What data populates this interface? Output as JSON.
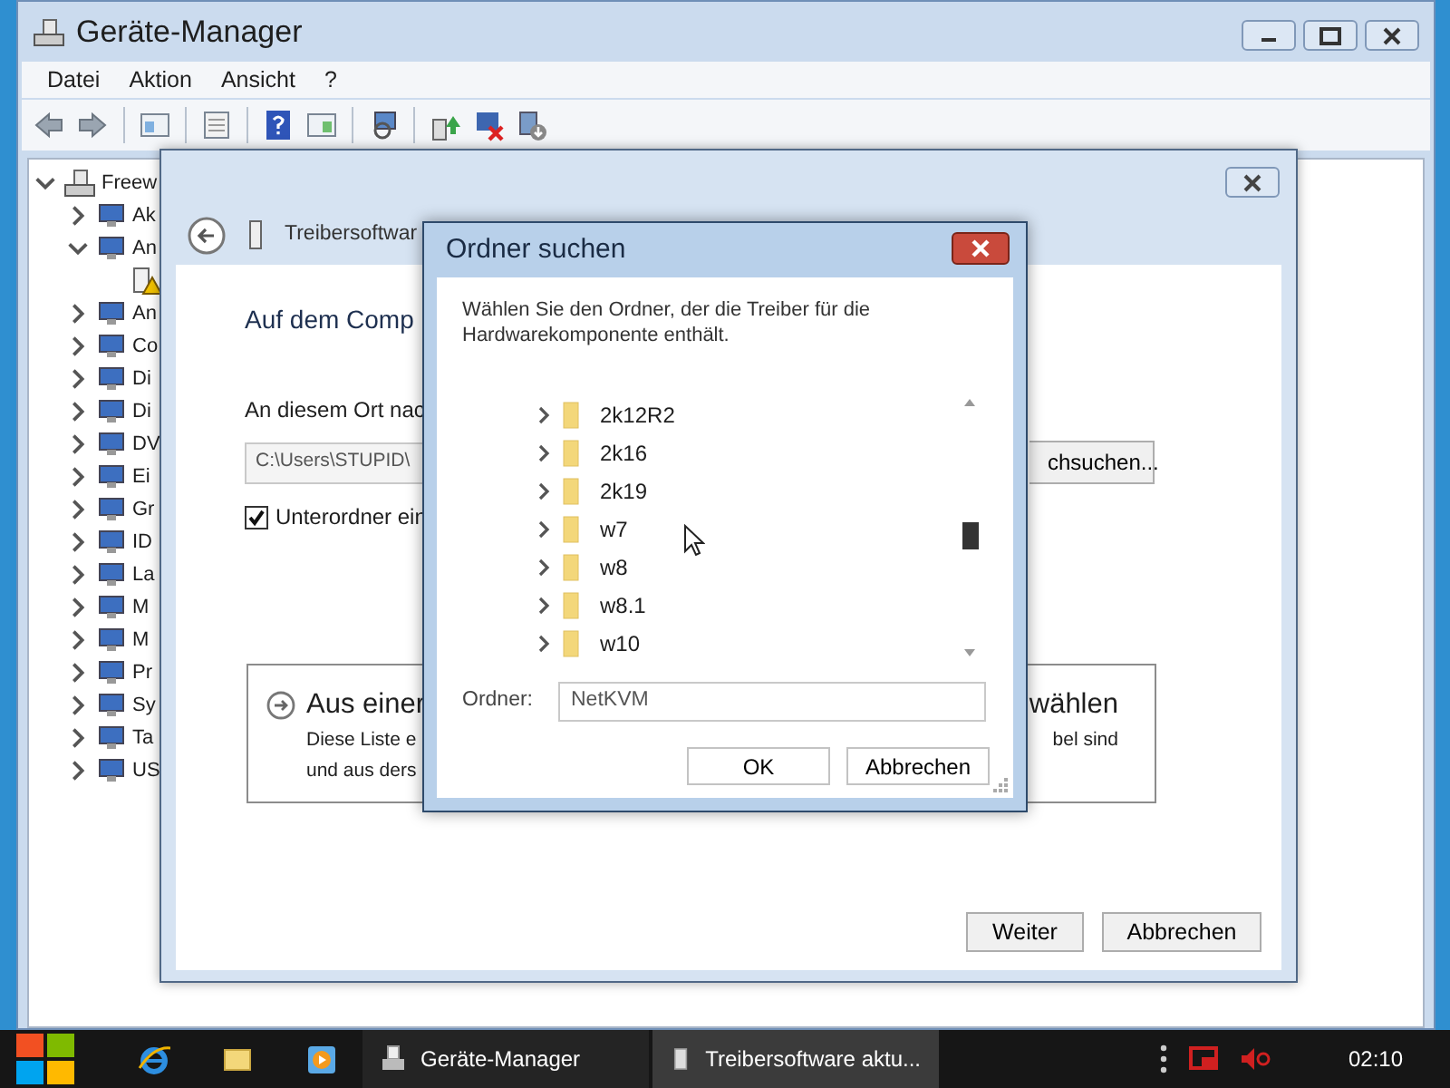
{
  "device_manager": {
    "title": "Geräte-Manager",
    "menu": [
      "Datei",
      "Aktion",
      "Ansicht",
      "?"
    ],
    "tree": [
      {
        "label": "Freew",
        "expanded": true,
        "children": [
          {
            "label": "Ak",
            "expanded": false
          },
          {
            "label": "An",
            "expanded": true,
            "children": [
              {
                "kind": "device-warning"
              }
            ]
          },
          {
            "label": "An",
            "expanded": false
          },
          {
            "label": "Co",
            "expanded": false
          },
          {
            "label": "Di",
            "expanded": false
          },
          {
            "label": "Di",
            "expanded": false
          },
          {
            "label": "DV",
            "expanded": false
          },
          {
            "label": "Ei",
            "expanded": false
          },
          {
            "label": "Gr",
            "expanded": false
          },
          {
            "label": "ID",
            "expanded": false
          },
          {
            "label": "La",
            "expanded": false
          },
          {
            "label": "M",
            "expanded": false
          },
          {
            "label": "M",
            "expanded": false
          },
          {
            "label": "Pr",
            "expanded": false
          },
          {
            "label": "Sy",
            "expanded": false
          },
          {
            "label": "Ta",
            "expanded": false
          },
          {
            "label": "US",
            "expanded": false
          }
        ]
      }
    ]
  },
  "wizard": {
    "title": "Treibersoftwar",
    "heading": "Auf dem Comp",
    "location_label": "An diesem Ort nac",
    "path_value": "C:\\Users\\STUPID\\",
    "browse_button": "chsuchen...",
    "subfolder_checkbox": {
      "label": "Unterordner ein",
      "checked": true
    },
    "option": {
      "title_left": "Aus einer",
      "title_right": "wählen",
      "lines": [
        {
          "left": "Diese Liste e",
          "right": "bel sind"
        },
        {
          "left": "und aus ders"
        }
      ]
    },
    "buttons": [
      "Weiter",
      "Abbrechen"
    ]
  },
  "folder_dialog": {
    "title": "Ordner suchen",
    "description": "Wählen Sie den Ordner, der die Treiber für die Hardwarekomponente enthält.",
    "folders": [
      {
        "label": "2k12R2",
        "expanded": false
      },
      {
        "label": "2k16",
        "expanded": false
      },
      {
        "label": "2k19",
        "expanded": false
      },
      {
        "label": "w7",
        "expanded": false
      },
      {
        "label": "w8",
        "expanded": false
      },
      {
        "label": "w8.1",
        "expanded": false
      },
      {
        "label": "w10",
        "expanded": false
      }
    ],
    "folder_label": "Ordner:",
    "folder_value": "NetKVM",
    "buttons": [
      "OK",
      "Abbrechen"
    ]
  },
  "taskbar": {
    "tasks": [
      {
        "label": "Geräte-Manager",
        "selected": false
      },
      {
        "label": "Treibersoftware aktu...",
        "selected": true
      }
    ],
    "clock": "02:10"
  }
}
